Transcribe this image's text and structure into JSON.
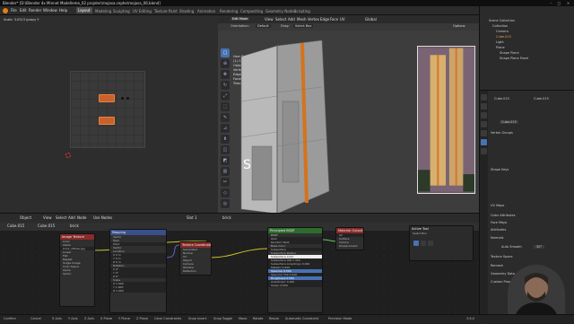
{
  "titlebar": {
    "title": "Blender* [D:\\Blender 4x Minnet Modelleme_02 projeler\\mojasa.cephe\\mojasa_06.blend]",
    "minimize": "–",
    "maximize": "□",
    "close": "×"
  },
  "menubar": {
    "menus": [
      "File",
      "Edit",
      "Render",
      "Window",
      "Help"
    ],
    "workspaces": [
      "Layout",
      "Modeling",
      "Sculpting",
      "UV Editing",
      "Texture Paint",
      "Shading",
      "Animation",
      "Rendering",
      "Compositing",
      "Geometry Nodes",
      "Scripting"
    ],
    "active_workspace": "Layout",
    "scene": "Scene",
    "view_layer": "ViewLayer"
  },
  "left_panel": {
    "scale_label": "Scale: 3.0313 (proxy Y"
  },
  "viewport": {
    "mode": "Edit Mode",
    "menus": [
      "View",
      "Select",
      "Add",
      "Mesh",
      "Vertex",
      "Edge",
      "Face",
      "UV"
    ],
    "transform": "Global",
    "orientation_label": "Orientation:",
    "orientation_value": "Default",
    "drag_label": "Drag:",
    "drag_value": "Select Box",
    "options_label": "Options",
    "stats": [
      "User Perspective",
      "(1) Cube.015",
      "",
      "Objects  1 / 1",
      "Vertices  3 / 76",
      "Edges  4 / 78",
      "Faces  0 / 28",
      "Triangles  44"
    ],
    "scale_letter": "S"
  },
  "outliner": {
    "title": "Scene Collection",
    "items": [
      "Scene Collection",
      "Collection",
      "Camera",
      "Cube.015",
      "Light",
      "Plane",
      "Shape Plane",
      "Shape Plane Fixed"
    ]
  },
  "properties": {
    "object_name": "Cube.015",
    "data_name": "Cube.015",
    "sections": [
      "Vertex Groups",
      "Shape Keys",
      "UV Maps",
      "Color Attributes",
      "Face Maps",
      "Attributes",
      "Normals",
      "Auto Smooth",
      "Texture Space",
      "Remesh",
      "Geometry Data",
      "Custom Properties"
    ],
    "auto_smooth_value": "30°"
  },
  "node_editor": {
    "header_menus": [
      "View",
      "Select",
      "Add",
      "Node"
    ],
    "use_nodes": "Use Nodes",
    "object_label": "Object",
    "slot": "Slot 1",
    "material": "brick",
    "breadcrumb": [
      "Cube.015",
      "Cube.015",
      "brick"
    ],
    "nodes": {
      "texture": {
        "title": "Image Texture",
        "rows": [
          "Color",
          "Alpha",
          "brick_diffuse.jpg",
          "Linear",
          "Flat",
          "Repeat",
          "Single Image",
          "Color Space",
          "Alpha",
          "Vector"
        ]
      },
      "mapping": {
        "title": "Mapping",
        "rows": [
          "Vector",
          "Type",
          "Point",
          "Vector",
          "Location",
          "X 0 m",
          "Y 0 m",
          "Z 0 m",
          "Rotation",
          "X 0°",
          "Y 0°",
          "Z 0°",
          "Scale",
          "X 1.000",
          "Y 1.000",
          "Z 1.000"
        ]
      },
      "coord": {
        "title": "Texture Coordinate",
        "rows": [
          "Generated",
          "Normal",
          "UV",
          "Object",
          "Camera",
          "Window",
          "Reflection"
        ]
      },
      "bsdf": {
        "title": "Principled BSDF",
        "rows": [
          "BSDF",
          "GGX",
          "Random Walk",
          "Base Color",
          "Subsurface",
          "Subsurface Radius",
          "Subsurface Color",
          "Subsurface IOR 1.400",
          "Subsurface Anisotropy 0.000",
          "Metallic 0.000",
          "Specular 0.500",
          "Specular Tint 0.000",
          "Roughness 0.500",
          "Anisotropic 0.000",
          "Sheen 0.000"
        ]
      },
      "output": {
        "title": "Material Output",
        "rows": [
          "All",
          "Surface",
          "Volume",
          "Displacement"
        ]
      },
      "panel": {
        "title": "Active Tool",
        "rows": [
          "Select Box"
        ]
      }
    }
  },
  "statusbar": {
    "items": [
      "Confirm",
      "Cancel",
      "X Axis",
      "Y Axis",
      "Z Axis",
      "X Plane",
      "Y Plane",
      "Z Plane",
      "Clear Constraints",
      "Snap Invert",
      "Snap Toggle",
      "Move",
      "Rotate",
      "Resize",
      "Automatic Constraint",
      "Precision Mode"
    ],
    "version": "3.6.0"
  },
  "colors": {
    "accent": "#4772b3",
    "texture_orange": "#c8612b",
    "node_red": "#8b2a2a",
    "node_blue": "#3b4f8a",
    "node_green": "#2e6b2e"
  }
}
